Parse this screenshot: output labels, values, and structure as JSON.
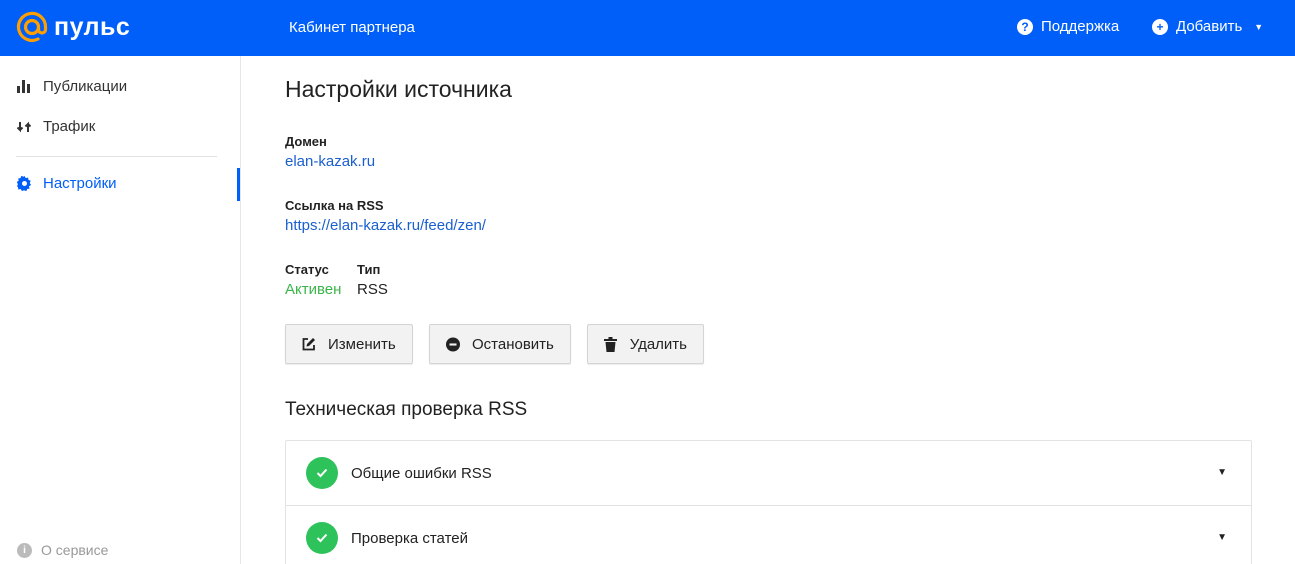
{
  "header": {
    "logo_text": "пульс",
    "title": "Кабинет партнера",
    "support_label": "Поддержка",
    "add_label": "Добавить",
    "brand_color": "#005ff9",
    "logo_color": "#ff9e00"
  },
  "sidebar": {
    "items": [
      {
        "label": "Публикации",
        "icon": "bar-chart-icon"
      },
      {
        "label": "Трафик",
        "icon": "exchange-arrows-icon"
      },
      {
        "label": "Настройки",
        "icon": "gear-icon",
        "active": true
      }
    ],
    "about_label": "О сервисе"
  },
  "main": {
    "title": "Настройки источника",
    "domain_label": "Домен",
    "domain_value": "elan-kazak.ru",
    "rss_label": "Ссылка на RSS",
    "rss_value": "https://elan-kazak.ru/feed/zen/",
    "status_label": "Статус",
    "status_value": "Активен",
    "status_color": "#39b54a",
    "type_label": "Тип",
    "type_value": "RSS",
    "buttons": {
      "edit": "Изменить",
      "stop": "Остановить",
      "delete": "Удалить"
    },
    "tech_title": "Техническая проверка RSS",
    "checks": [
      {
        "label": "Общие ошибки RSS",
        "status": "ok"
      },
      {
        "label": "Проверка статей",
        "status": "ok"
      }
    ]
  }
}
